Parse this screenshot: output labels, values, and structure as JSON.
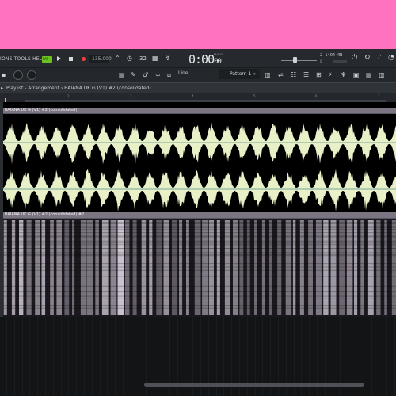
{
  "menu": {
    "label": "IONS TOOLS HELP"
  },
  "pattern_badge": "PAT",
  "tempo": "135.000",
  "time_display": {
    "main": "0:00",
    "sub": "00",
    "unit": "M:S:CS"
  },
  "cpu": {
    "voices": "2",
    "memory": "1404 MB",
    "voices_sub": "0"
  },
  "snap": {
    "label": "Line"
  },
  "pattern_selector": {
    "label": "Pattern 1"
  },
  "breadcrumb": {
    "text": "Playlist - Arrangement  ›  BAIANA UK G (V1) #2 (consolidated)"
  },
  "ruler": {
    "bars": [
      "2",
      "3",
      "4",
      "5",
      "6",
      "7"
    ]
  },
  "tracks": [
    {
      "clip_label": "BAIANA UK G (V1) #2 (consolidated)",
      "display": "waveform"
    },
    {
      "clip_label": "BAIANA UK G (V1) #2 (consolidated) #2",
      "display": "spectrogram"
    }
  ],
  "colors": {
    "accent_pink": "#ff72c0",
    "waveform_fill": "#e8f0c8",
    "clip_header": "#7b7582",
    "pattern_badge_green": "#6bc21e",
    "record_red": "#f04040"
  }
}
